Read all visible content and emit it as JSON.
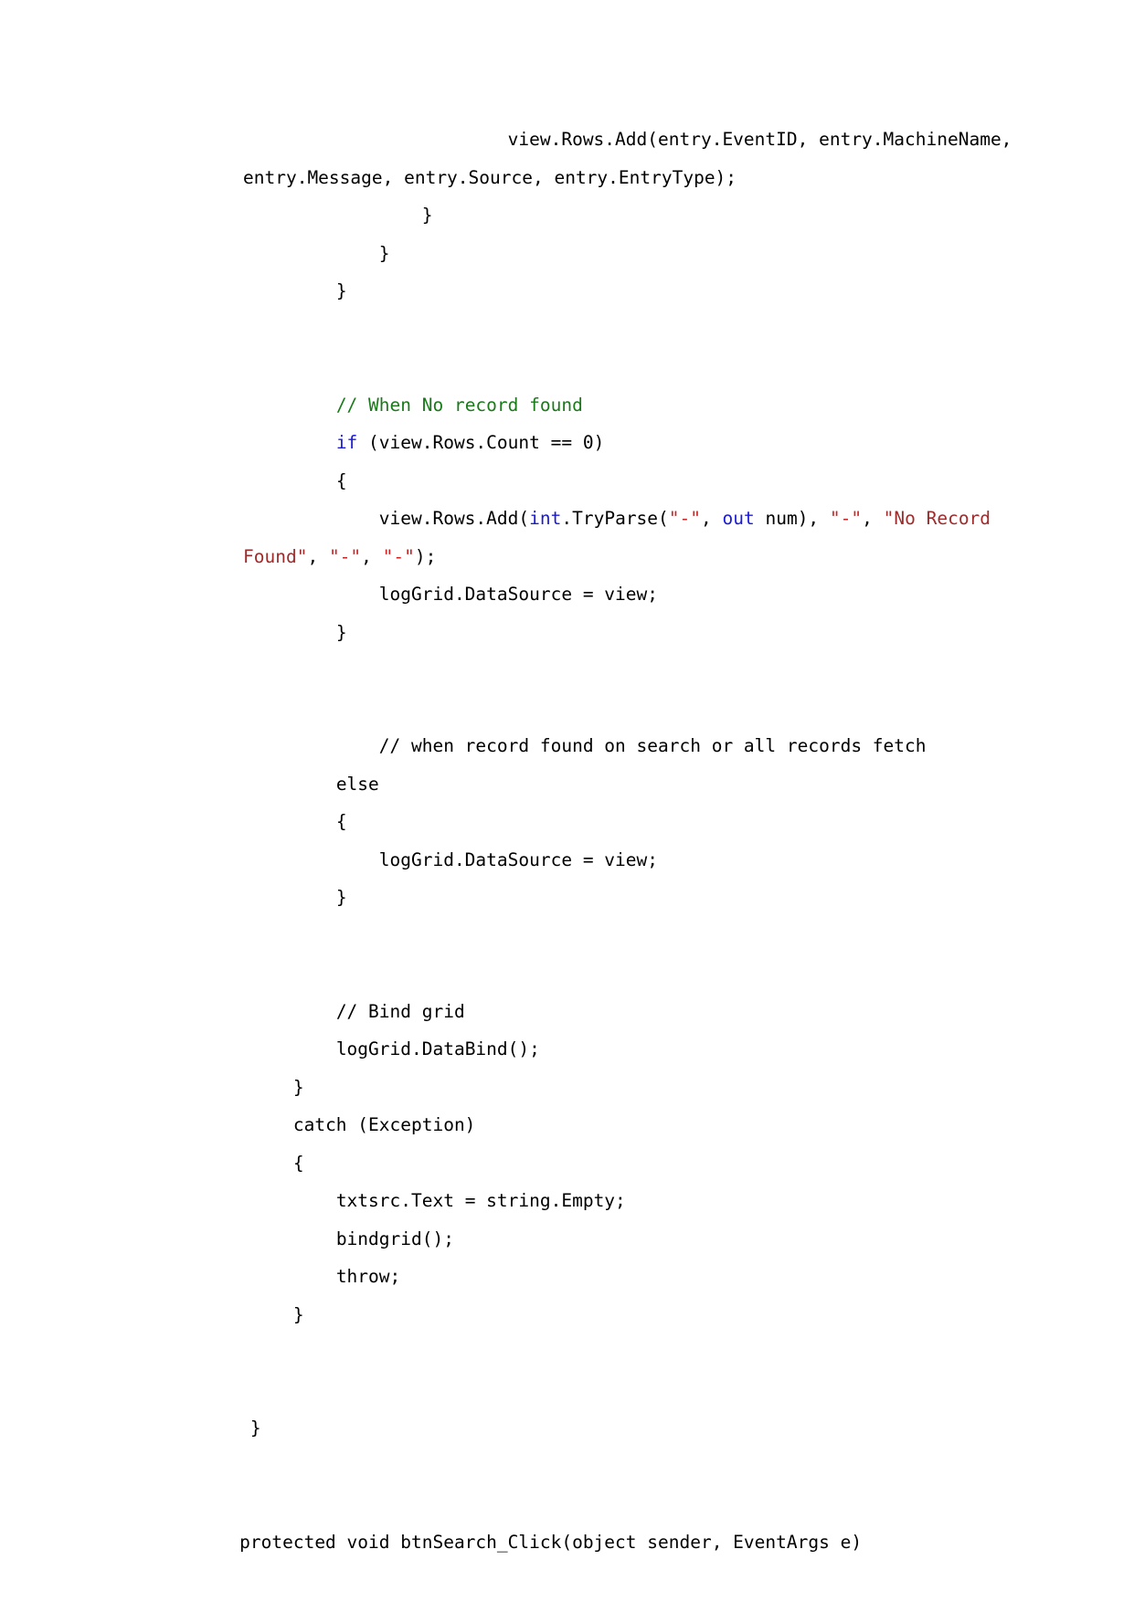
{
  "document": {
    "page_background": "#ffffff",
    "text_color": "#000000",
    "colors": {
      "comment_green": "#1a7a1a",
      "keyword_blue": "#1919d8",
      "string_red": "#cc2222",
      "string_dark_red": "#9e2b2b"
    },
    "code_lines": [
      {
        "id": "line-1",
        "indent": 36,
        "wraps": true,
        "tokens": [
          {
            "text": "view.Rows.Add(entry.EventID, entry.MachineName, entry.Message, entry.Source, entry.EntryType);",
            "style": "plain"
          }
        ]
      },
      {
        "id": "line-2",
        "indent": 28,
        "wraps": false,
        "tokens": [
          {
            "text": "}",
            "style": "plain"
          }
        ]
      },
      {
        "id": "line-3",
        "indent": 24,
        "wraps": false,
        "tokens": [
          {
            "text": "}",
            "style": "plain"
          }
        ]
      },
      {
        "id": "line-4",
        "indent": 20,
        "wraps": false,
        "tokens": [
          {
            "text": "}",
            "style": "plain"
          }
        ]
      },
      {
        "id": "line-5",
        "indent": 0,
        "wraps": false,
        "tokens": []
      },
      {
        "id": "line-6",
        "indent": 0,
        "wraps": false,
        "tokens": []
      },
      {
        "id": "line-7",
        "indent": 20,
        "wraps": false,
        "tokens": [
          {
            "text": "// When No record found",
            "style": "comment-green"
          }
        ]
      },
      {
        "id": "line-8",
        "indent": 20,
        "wraps": false,
        "tokens": [
          {
            "text": "if",
            "style": "keyword"
          },
          {
            "text": " (view.Rows.Count == 0)",
            "style": "plain"
          }
        ]
      },
      {
        "id": "line-9",
        "indent": 20,
        "wraps": false,
        "tokens": [
          {
            "text": "{",
            "style": "plain"
          }
        ]
      },
      {
        "id": "line-10",
        "indent": 24,
        "wraps": true,
        "tokens": [
          {
            "text": "view.Rows.Add(",
            "style": "plain"
          },
          {
            "text": "int",
            "style": "keyword"
          },
          {
            "text": ".TryParse(",
            "style": "plain"
          },
          {
            "text": "\"-\"",
            "style": "string"
          },
          {
            "text": ", ",
            "style": "plain"
          },
          {
            "text": "out",
            "style": "keyword"
          },
          {
            "text": " num), ",
            "style": "plain"
          },
          {
            "text": "\"-\"",
            "style": "string"
          },
          {
            "text": ", ",
            "style": "plain"
          },
          {
            "text": "\"No Record Found\"",
            "style": "string-dark"
          },
          {
            "text": ", ",
            "style": "plain"
          },
          {
            "text": "\"-\"",
            "style": "string"
          },
          {
            "text": ", ",
            "style": "plain"
          },
          {
            "text": "\"-\"",
            "style": "string"
          },
          {
            "text": ");",
            "style": "plain"
          }
        ]
      },
      {
        "id": "line-11",
        "indent": 24,
        "wraps": false,
        "tokens": [
          {
            "text": "logGrid.DataSource = view;",
            "style": "plain"
          }
        ]
      },
      {
        "id": "line-12",
        "indent": 20,
        "wraps": false,
        "tokens": [
          {
            "text": "}",
            "style": "plain"
          }
        ]
      },
      {
        "id": "line-13",
        "indent": 0,
        "wraps": false,
        "tokens": []
      },
      {
        "id": "line-14",
        "indent": 0,
        "wraps": false,
        "tokens": []
      },
      {
        "id": "line-15",
        "indent": 24,
        "wraps": false,
        "tokens": [
          {
            "text": "// when record found on search or all records fetch",
            "style": "plain"
          }
        ]
      },
      {
        "id": "line-16",
        "indent": 20,
        "wraps": false,
        "tokens": [
          {
            "text": "else",
            "style": "plain"
          }
        ]
      },
      {
        "id": "line-17",
        "indent": 20,
        "wraps": false,
        "tokens": [
          {
            "text": "{",
            "style": "plain"
          }
        ]
      },
      {
        "id": "line-18",
        "indent": 24,
        "wraps": false,
        "tokens": [
          {
            "text": "logGrid.DataSource = view;",
            "style": "plain"
          }
        ]
      },
      {
        "id": "line-19",
        "indent": 20,
        "wraps": false,
        "tokens": [
          {
            "text": "}",
            "style": "plain"
          }
        ]
      },
      {
        "id": "line-20",
        "indent": 0,
        "wraps": false,
        "tokens": []
      },
      {
        "id": "line-21",
        "indent": 0,
        "wraps": false,
        "tokens": []
      },
      {
        "id": "line-22",
        "indent": 20,
        "wraps": false,
        "tokens": [
          {
            "text": "// Bind grid",
            "style": "plain"
          }
        ]
      },
      {
        "id": "line-23",
        "indent": 20,
        "wraps": false,
        "tokens": [
          {
            "text": "logGrid.DataBind();",
            "style": "plain"
          }
        ]
      },
      {
        "id": "line-24",
        "indent": 16,
        "wraps": false,
        "tokens": [
          {
            "text": "}",
            "style": "plain"
          }
        ]
      },
      {
        "id": "line-25",
        "indent": 16,
        "wraps": false,
        "tokens": [
          {
            "text": "catch (Exception)",
            "style": "plain"
          }
        ]
      },
      {
        "id": "line-26",
        "indent": 16,
        "wraps": false,
        "tokens": [
          {
            "text": "{",
            "style": "plain"
          }
        ]
      },
      {
        "id": "line-27",
        "indent": 20,
        "wraps": false,
        "tokens": [
          {
            "text": "txtsrc.Text = string.Empty;",
            "style": "plain"
          }
        ]
      },
      {
        "id": "line-28",
        "indent": 20,
        "wraps": false,
        "tokens": [
          {
            "text": "bindgrid();",
            "style": "plain"
          }
        ]
      },
      {
        "id": "line-29",
        "indent": 20,
        "wraps": false,
        "tokens": [
          {
            "text": "throw;",
            "style": "plain"
          }
        ]
      },
      {
        "id": "line-30",
        "indent": 16,
        "wraps": false,
        "tokens": [
          {
            "text": "}",
            "style": "plain"
          }
        ]
      },
      {
        "id": "line-31",
        "indent": 0,
        "wraps": false,
        "tokens": []
      },
      {
        "id": "line-32",
        "indent": 0,
        "wraps": false,
        "tokens": []
      },
      {
        "id": "line-33",
        "indent": 12,
        "wraps": false,
        "tokens": [
          {
            "text": "}",
            "style": "plain"
          }
        ]
      },
      {
        "id": "line-34",
        "indent": 0,
        "wraps": false,
        "tokens": []
      },
      {
        "id": "line-35",
        "indent": 0,
        "wraps": false,
        "tokens": []
      },
      {
        "id": "line-36",
        "indent": 11,
        "wraps": false,
        "tokens": [
          {
            "text": "protected void btnSearch_Click(object sender, EventArgs e)",
            "style": "plain"
          }
        ]
      }
    ]
  }
}
